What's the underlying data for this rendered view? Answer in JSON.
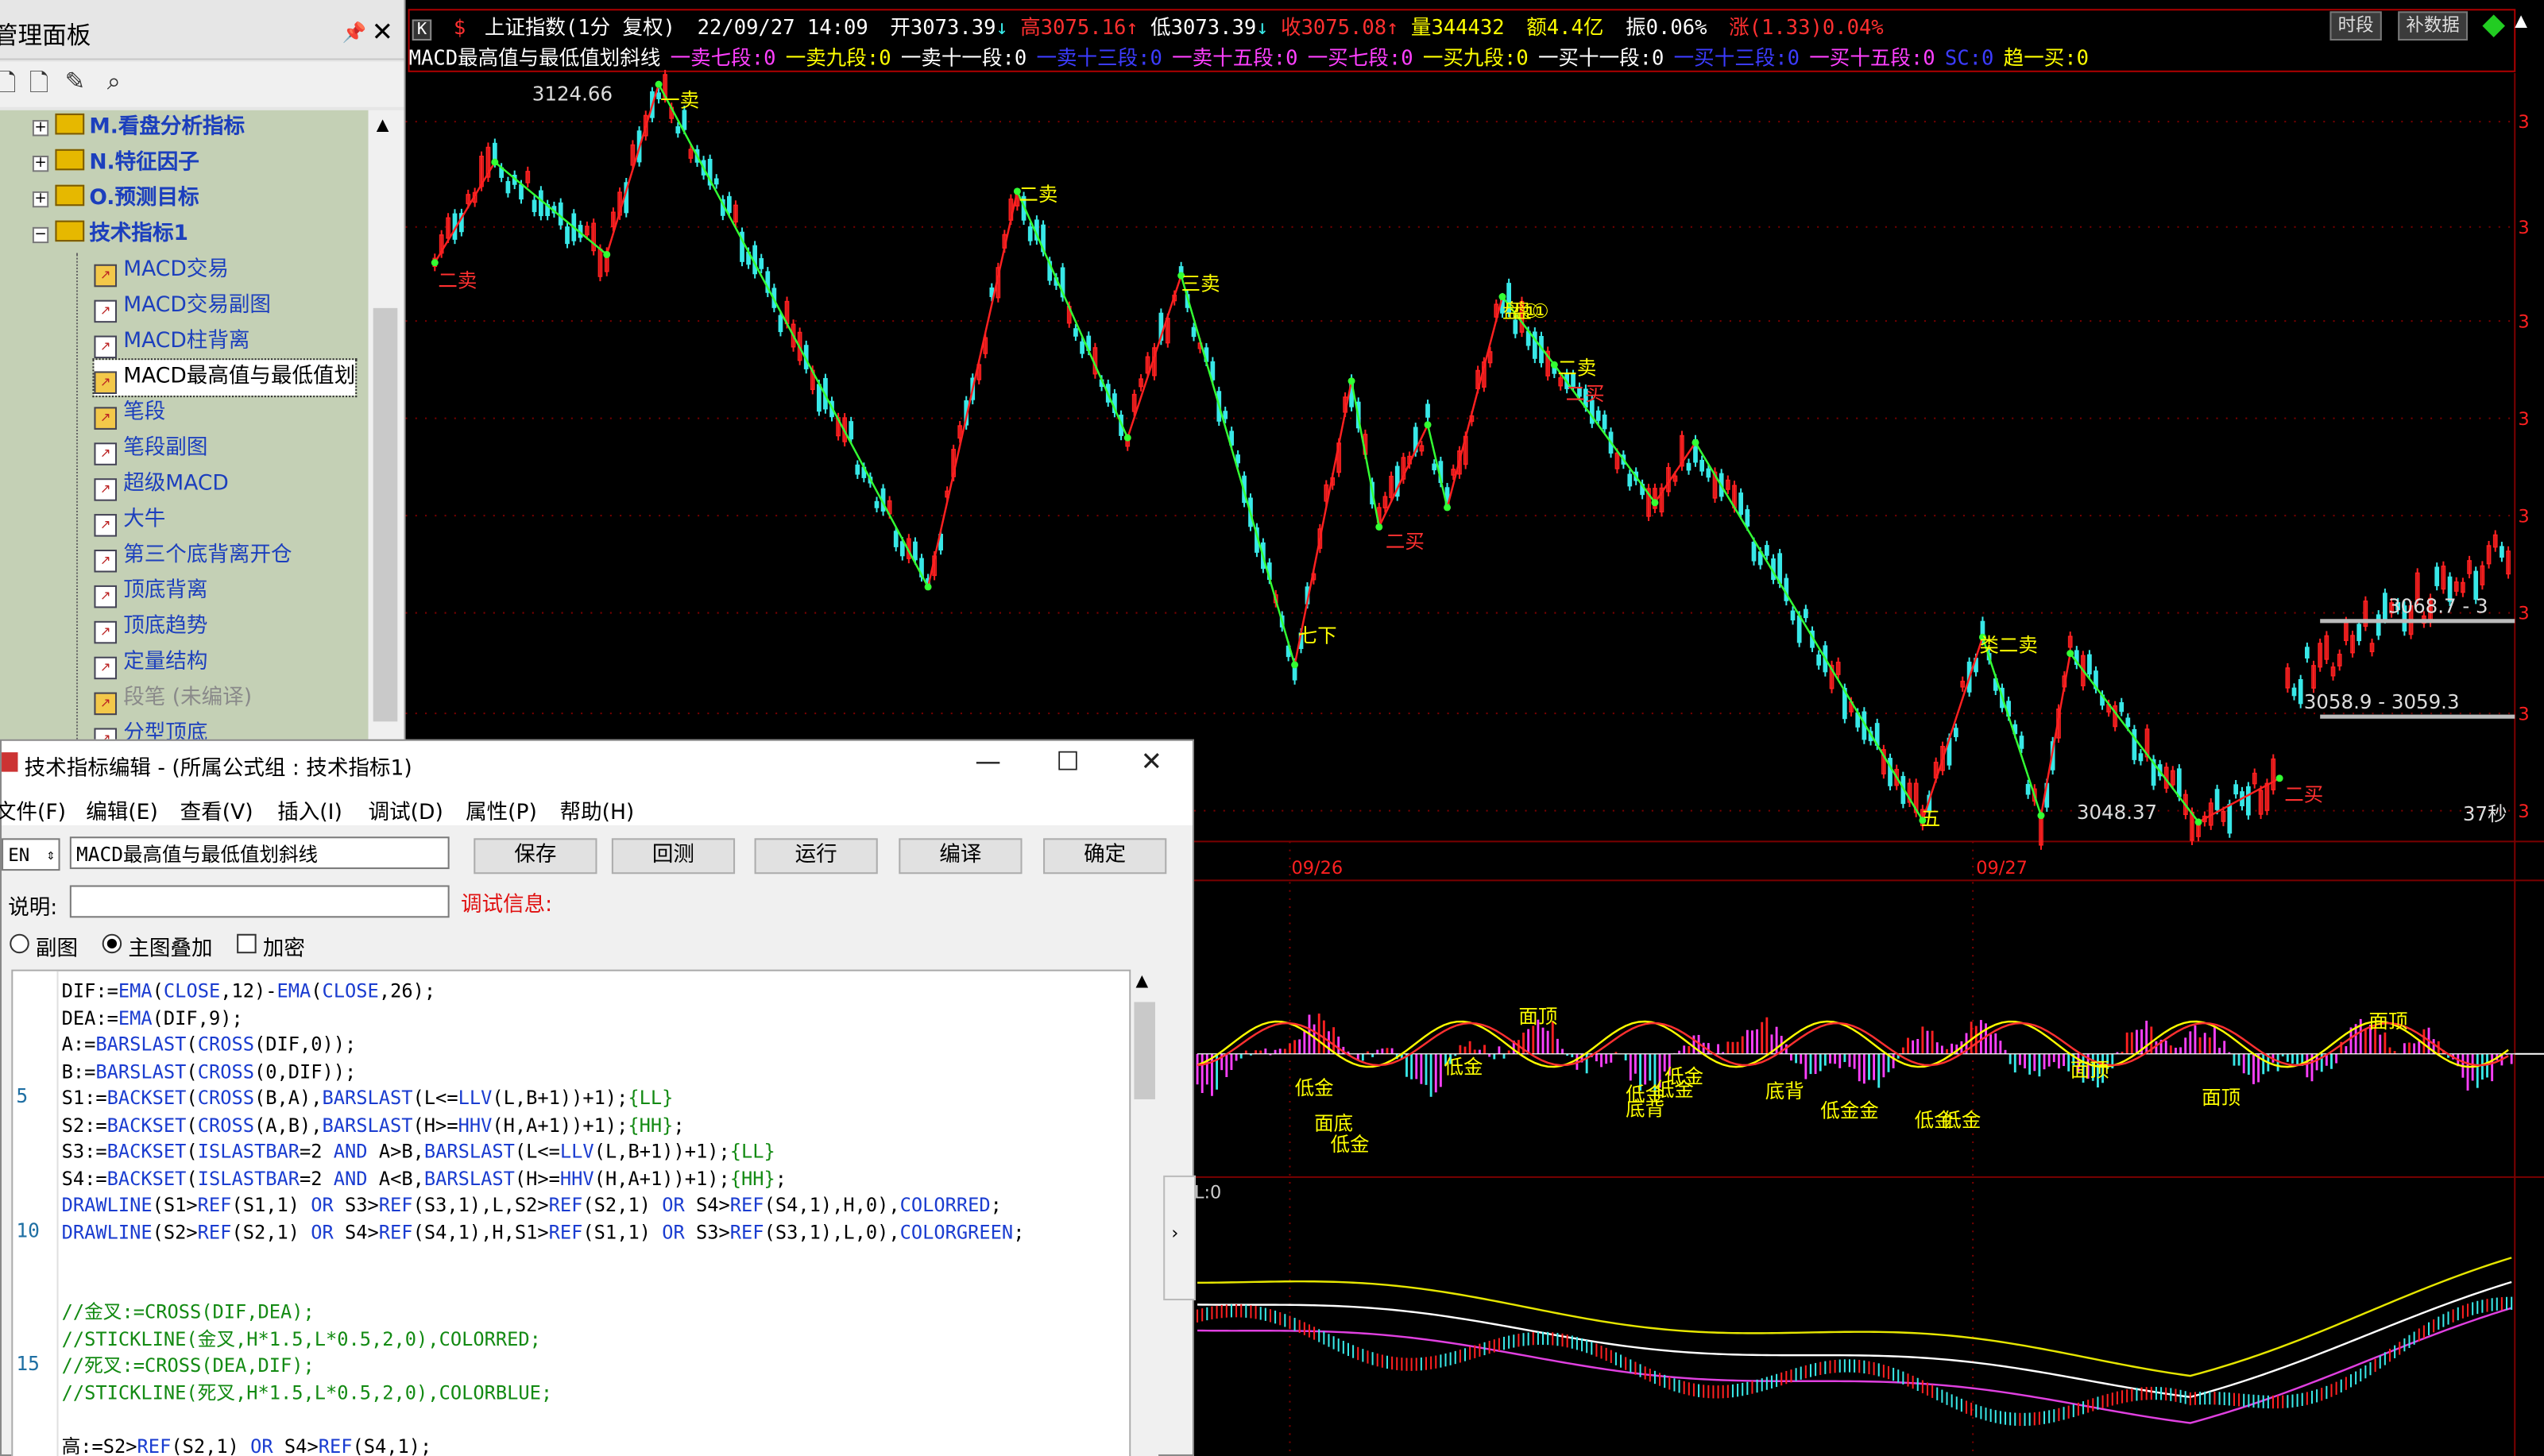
{
  "mgr": {
    "title": "管理面板",
    "pin": "ꟷ",
    "close": "✕",
    "tree": [
      {
        "label": "M.看盘分析指标",
        "type": "folder",
        "pm": "+"
      },
      {
        "label": "N.特征因子",
        "type": "folder",
        "pm": "+"
      },
      {
        "label": "O.预测目标",
        "type": "folder",
        "pm": "+"
      },
      {
        "label": "技术指标1",
        "type": "folder",
        "pm": "−"
      },
      {
        "label": "MACD交易",
        "type": "item-y"
      },
      {
        "label": "MACD交易副图",
        "type": "item"
      },
      {
        "label": "MACD柱背离",
        "type": "item"
      },
      {
        "label": "MACD最高值与最低值划",
        "type": "item-y",
        "selected": true
      },
      {
        "label": "笔段",
        "type": "item-y"
      },
      {
        "label": "笔段副图",
        "type": "item"
      },
      {
        "label": "超级MACD",
        "type": "item"
      },
      {
        "label": "大牛",
        "type": "item"
      },
      {
        "label": "第三个底背离开仓",
        "type": "item"
      },
      {
        "label": "顶底背离",
        "type": "item"
      },
      {
        "label": "顶底趋势",
        "type": "item"
      },
      {
        "label": "定量结构",
        "type": "item"
      },
      {
        "label": "段笔 (未编译)",
        "type": "item-y",
        "disabled": true
      },
      {
        "label": "分型顶底",
        "type": "item"
      }
    ]
  },
  "chart_header": {
    "mode": "K",
    "name": "上证指数(1分 复权)",
    "datetime": "22/09/27 14:09",
    "open": "开3073.39",
    "high": "高3075.16",
    "low": "低3073.39",
    "close": "收3075.08",
    "vol": "量344432",
    "amount": "额4.4亿",
    "amp": "振0.06%",
    "chg": "涨(1.33)0.04%",
    "btn_timeshare": "时段",
    "btn_fill": "补数据",
    "indicator_line": [
      {
        "text": "MACD最高值与最低值划斜线",
        "color": "#ffffff"
      },
      {
        "text": "一卖七段:0",
        "color": "#ff40ff"
      },
      {
        "text": "一卖九段:0",
        "color": "#ffff00"
      },
      {
        "text": "一卖十一段:0",
        "color": "#ffffff"
      },
      {
        "text": "一卖十三段:0",
        "color": "#3c3cff"
      },
      {
        "text": "一卖十五段:0",
        "color": "#ff40ff"
      },
      {
        "text": "一买七段:0",
        "color": "#ff40ff"
      },
      {
        "text": "一买九段:0",
        "color": "#ffff00"
      },
      {
        "text": "一买十一段:0",
        "color": "#ffffff"
      },
      {
        "text": "一买十三段:0",
        "color": "#3c3cff"
      },
      {
        "text": "一买十五段:0",
        "color": "#ff40ff"
      },
      {
        "text": "SC:0",
        "color": "#3c3cff"
      },
      {
        "text": "趋一买:0",
        "color": "#ffff00"
      }
    ]
  },
  "price_labels": {
    "high_value": "3124.66",
    "low_value": "3048.37",
    "band1": "3068.7 - 3",
    "band2": "3058.9 - 3059.3",
    "seconds": "37秒",
    "date1": "09/26",
    "date2": "09/27",
    "macd_l": "L:0"
  },
  "signals": [
    {
      "text": "二卖",
      "color": "#ff3030"
    },
    {
      "text": "一卖",
      "color": "#ffff00"
    },
    {
      "text": "二卖",
      "color": "#ffff00"
    },
    {
      "text": "三卖",
      "color": "#ffff00"
    },
    {
      "text": "七下",
      "color": "#ffff00"
    },
    {
      "text": "二买",
      "color": "#ff3030"
    },
    {
      "text": "盘①",
      "color": "#ffff00"
    },
    {
      "text": "盘①",
      "color": "#ffff00"
    },
    {
      "text": "二卖",
      "color": "#ffff00"
    },
    {
      "text": "二买",
      "color": "#ff3030"
    },
    {
      "text": "五",
      "color": "#ffff00"
    },
    {
      "text": "类二卖",
      "color": "#ffff00"
    },
    {
      "text": "二买",
      "color": "#ff3030"
    }
  ],
  "macd_labels": [
    {
      "text": "低金",
      "color": "#ffff00"
    },
    {
      "text": "面底",
      "color": "#ffff00"
    },
    {
      "text": "低金",
      "color": "#ffff00"
    },
    {
      "text": "低金",
      "color": "#ffff00"
    },
    {
      "text": "面顶",
      "color": "#ffff00"
    },
    {
      "text": "低金",
      "color": "#ffff00"
    },
    {
      "text": "底背",
      "color": "#ffff00"
    },
    {
      "text": "低金",
      "color": "#ffff00"
    },
    {
      "text": "低金",
      "color": "#ffff00"
    },
    {
      "text": "底背",
      "color": "#ffff00"
    },
    {
      "text": "低金金",
      "color": "#ffff00"
    },
    {
      "text": "低金",
      "color": "#ffff00"
    },
    {
      "text": "低金",
      "color": "#ffff00"
    },
    {
      "text": "面顶",
      "color": "#ffff00"
    },
    {
      "text": "面顶",
      "color": "#ffff00"
    },
    {
      "text": "面顶",
      "color": "#ffff00"
    }
  ],
  "dialog": {
    "title": "技术指标编辑 - (所属公式组 : 技术指标1)",
    "menu": [
      "文件(F)",
      "编辑(E)",
      "查看(V)",
      "插入(I)",
      "调试(D)",
      "属性(P)",
      "帮助(H)"
    ],
    "lang": "EN",
    "name_value": "MACD最高值与最低值划斜线",
    "desc_label": "说明:",
    "debug_label": "调试信息:",
    "buttons": [
      "保存",
      "回测",
      "运行",
      "编译",
      "确定"
    ],
    "radio_sub": "副图",
    "radio_main": "主图叠加",
    "check_enc": "加密",
    "code": [
      "DIF:=EMA(CLOSE,12)-EMA(CLOSE,26);",
      "DEA:=EMA(DIF,9);",
      "A:=BARSLAST(CROSS(DIF,0));",
      "B:=BARSLAST(CROSS(0,DIF));",
      "S1:=BACKSET(CROSS(B,A),BARSLAST(L<=LLV(L,B+1))+1);{LL}",
      "S2:=BACKSET(CROSS(A,B),BARSLAST(H>=HHV(H,A+1))+1);{HH};",
      "S3:=BACKSET(ISLASTBAR=2 AND A>B,BARSLAST(L<=LLV(L,B+1))+1);{LL}",
      "S4:=BACKSET(ISLASTBAR=2 AND A<B,BARSLAST(H>=HHV(H,A+1))+1);{HH};",
      "DRAWLINE(S1>REF(S1,1) OR S3>REF(S3,1),L,S2>REF(S2,1) OR S4>REF(S4,1),H,0),COLORRED;",
      "DRAWLINE(S2>REF(S2,1) OR S4>REF(S4,1),H,S1>REF(S1,1) OR S3>REF(S3,1),L,0),COLORGREEN;",
      "",
      "",
      "//金叉:=CROSS(DIF,DEA);",
      "//STICKLINE(金叉,H*1.5,L*0.5,2,0),COLORRED;",
      "//死叉:=CROSS(DEA,DIF);",
      "//STICKLINE(死叉,H*1.5,L*0.5,2,0),COLORBLUE;",
      "",
      "高:=S2>REF(S2,1) OR S4>REF(S4,1);"
    ],
    "line_numbers": [
      "5",
      "10",
      "15"
    ]
  },
  "colors": {
    "zigzag_down": "#33ff33",
    "zigzag_up": "#ff2020",
    "candle_up": "#ff2020",
    "candle_down": "#38e8e8",
    "grid": "#7a0000",
    "ma_yellow": "#e6e600",
    "ma_white": "#ffffff",
    "ma_magenta": "#e040e0"
  }
}
